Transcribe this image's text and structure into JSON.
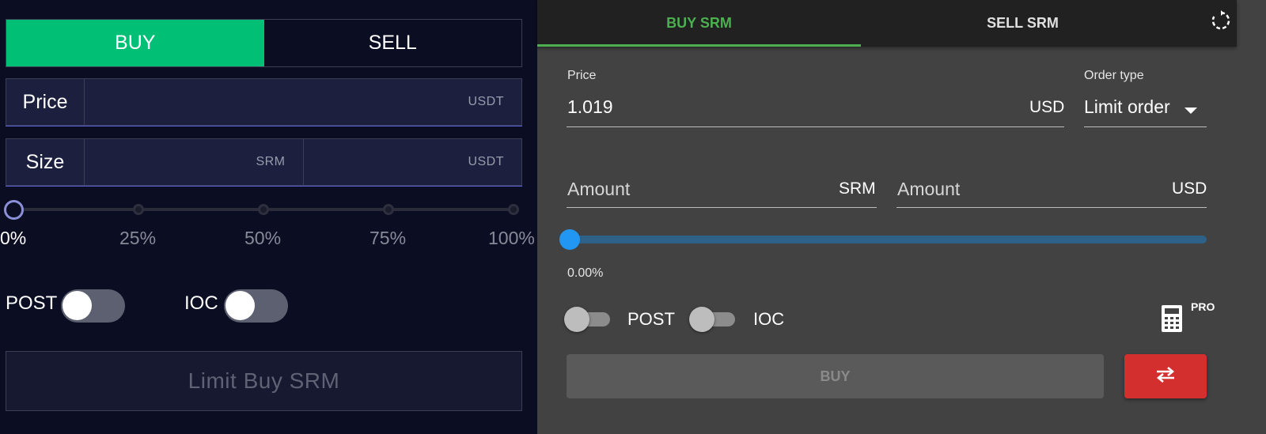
{
  "left": {
    "side": {
      "buy": "BUY",
      "sell": "SELL",
      "buy_color": "#02bf76"
    },
    "price": {
      "label": "Price",
      "unit": "USDT"
    },
    "size": {
      "label": "Size",
      "unit_base": "SRM",
      "unit_quote": "USDT"
    },
    "slider": {
      "value": 0,
      "marks": [
        "0%",
        "25%",
        "50%",
        "75%",
        "100%"
      ]
    },
    "toggles": {
      "post": "POST",
      "ioc": "IOC",
      "post_on": false,
      "ioc_on": false
    },
    "submit": "Limit Buy SRM"
  },
  "right": {
    "tabs": [
      {
        "label": "BUY SRM",
        "active": true
      },
      {
        "label": "SELL SRM",
        "active": false
      }
    ],
    "refresh_icon": "refresh-icon",
    "price": {
      "label": "Price",
      "value": "1.019",
      "unit": "USD"
    },
    "order_type": {
      "label": "Order type",
      "value": "Limit order"
    },
    "amount_base": {
      "placeholder": "Amount",
      "unit": "SRM"
    },
    "amount_quote": {
      "placeholder": "Amount",
      "unit": "USD"
    },
    "slider": {
      "value": 0,
      "display": "0.00%"
    },
    "toggles": {
      "post": "POST",
      "ioc": "IOC",
      "post_on": false,
      "ioc_on": false
    },
    "calculator_icon": "calculator-icon",
    "pro_badge": "PRO",
    "buy_button": "BUY",
    "swap_icon": "swap-icon",
    "accent_color": "#4caf50",
    "swap_color": "#d32f2f"
  }
}
